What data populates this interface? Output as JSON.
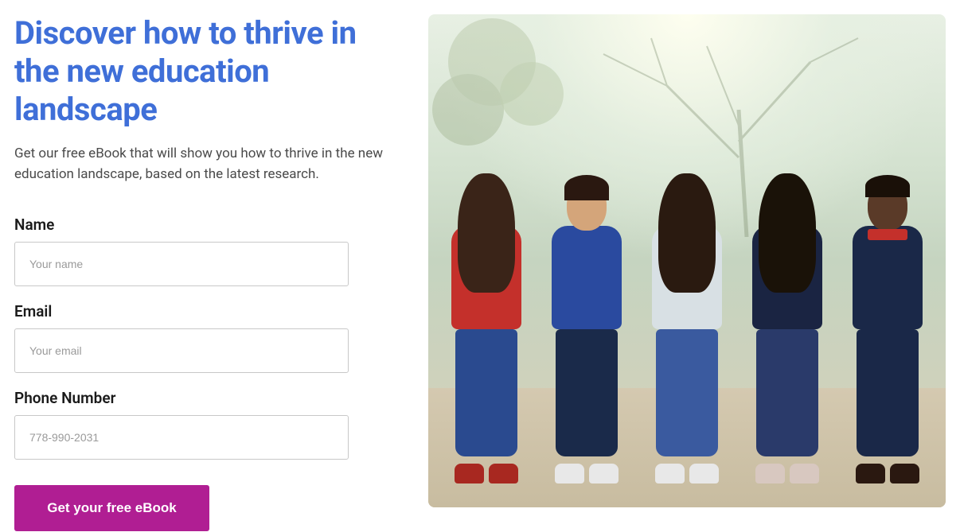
{
  "headline": "Discover how to thrive in the new education landscape",
  "subtext": "Get our free eBook that will show you how to thrive in the new education landscape, based on the latest research.",
  "form": {
    "name": {
      "label": "Name",
      "placeholder": "Your name",
      "value": ""
    },
    "email": {
      "label": "Email",
      "placeholder": "Your email",
      "value": ""
    },
    "phone": {
      "label": "Phone Number",
      "placeholder": "778-990-2031",
      "value": ""
    },
    "submit_label": "Get your free eBook"
  },
  "image": {
    "alt": "Five smiling young students sitting together on a wall outdoors"
  }
}
